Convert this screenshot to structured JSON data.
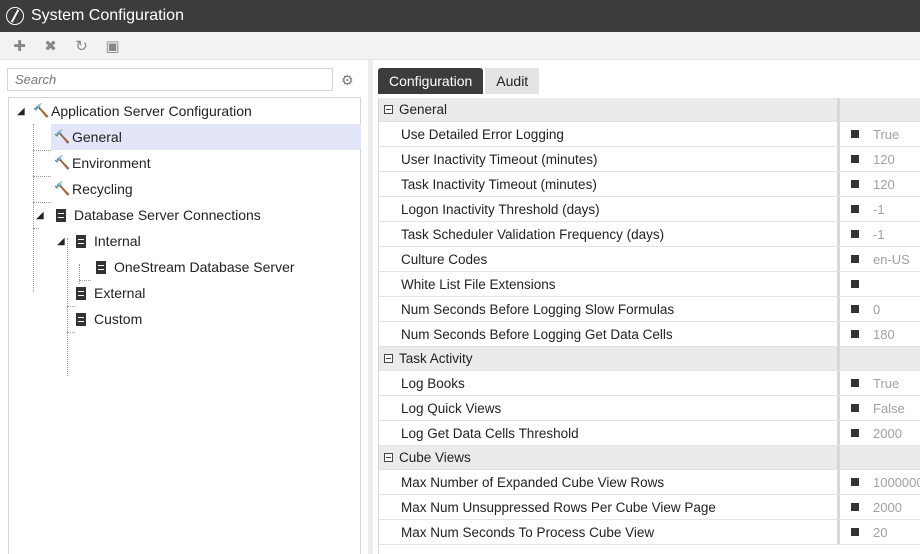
{
  "window": {
    "title": "System Configuration"
  },
  "toolbar": {
    "buttons": [
      {
        "name": "new-icon",
        "glyph": "✚"
      },
      {
        "name": "delete-icon",
        "glyph": "✖"
      },
      {
        "name": "refresh-icon",
        "glyph": "↻"
      },
      {
        "name": "save-icon",
        "glyph": "▣"
      }
    ]
  },
  "search": {
    "placeholder": "Search",
    "value": ""
  },
  "tree": {
    "root": "Application Server Configuration",
    "general": "General",
    "environment": "Environment",
    "recycling": "Recycling",
    "db_connections": "Database Server Connections",
    "internal": "Internal",
    "onestream_db": "OneStream Database Server",
    "external": "External",
    "custom": "Custom"
  },
  "tabs": {
    "configuration": "Configuration",
    "audit": "Audit"
  },
  "grid": {
    "categories": [
      {
        "name": "General",
        "properties": [
          {
            "name": "Use Detailed Error Logging",
            "value": "True"
          },
          {
            "name": "User Inactivity Timeout (minutes)",
            "value": "120"
          },
          {
            "name": "Task Inactivity Timeout (minutes)",
            "value": "120"
          },
          {
            "name": "Logon Inactivity Threshold (days)",
            "value": "-1"
          },
          {
            "name": "Task Scheduler Validation Frequency (days)",
            "value": "-1"
          },
          {
            "name": "Culture Codes",
            "value": "en-US"
          },
          {
            "name": "White List File Extensions",
            "value": ""
          },
          {
            "name": "Num Seconds Before Logging Slow Formulas",
            "value": "0"
          },
          {
            "name": "Num Seconds Before Logging Get Data Cells",
            "value": "180"
          }
        ]
      },
      {
        "name": "Task Activity",
        "properties": [
          {
            "name": "Log Books",
            "value": "True"
          },
          {
            "name": "Log Quick Views",
            "value": "False"
          },
          {
            "name": "Log Get Data Cells Threshold",
            "value": "2000"
          }
        ]
      },
      {
        "name": "Cube Views",
        "properties": [
          {
            "name": "Max Number of Expanded Cube View Rows",
            "value": "1000000"
          },
          {
            "name": "Max Num Unsuppressed Rows Per Cube View Page",
            "value": "2000"
          },
          {
            "name": "Max Num Seconds To Process Cube View",
            "value": "20"
          }
        ]
      }
    ]
  }
}
